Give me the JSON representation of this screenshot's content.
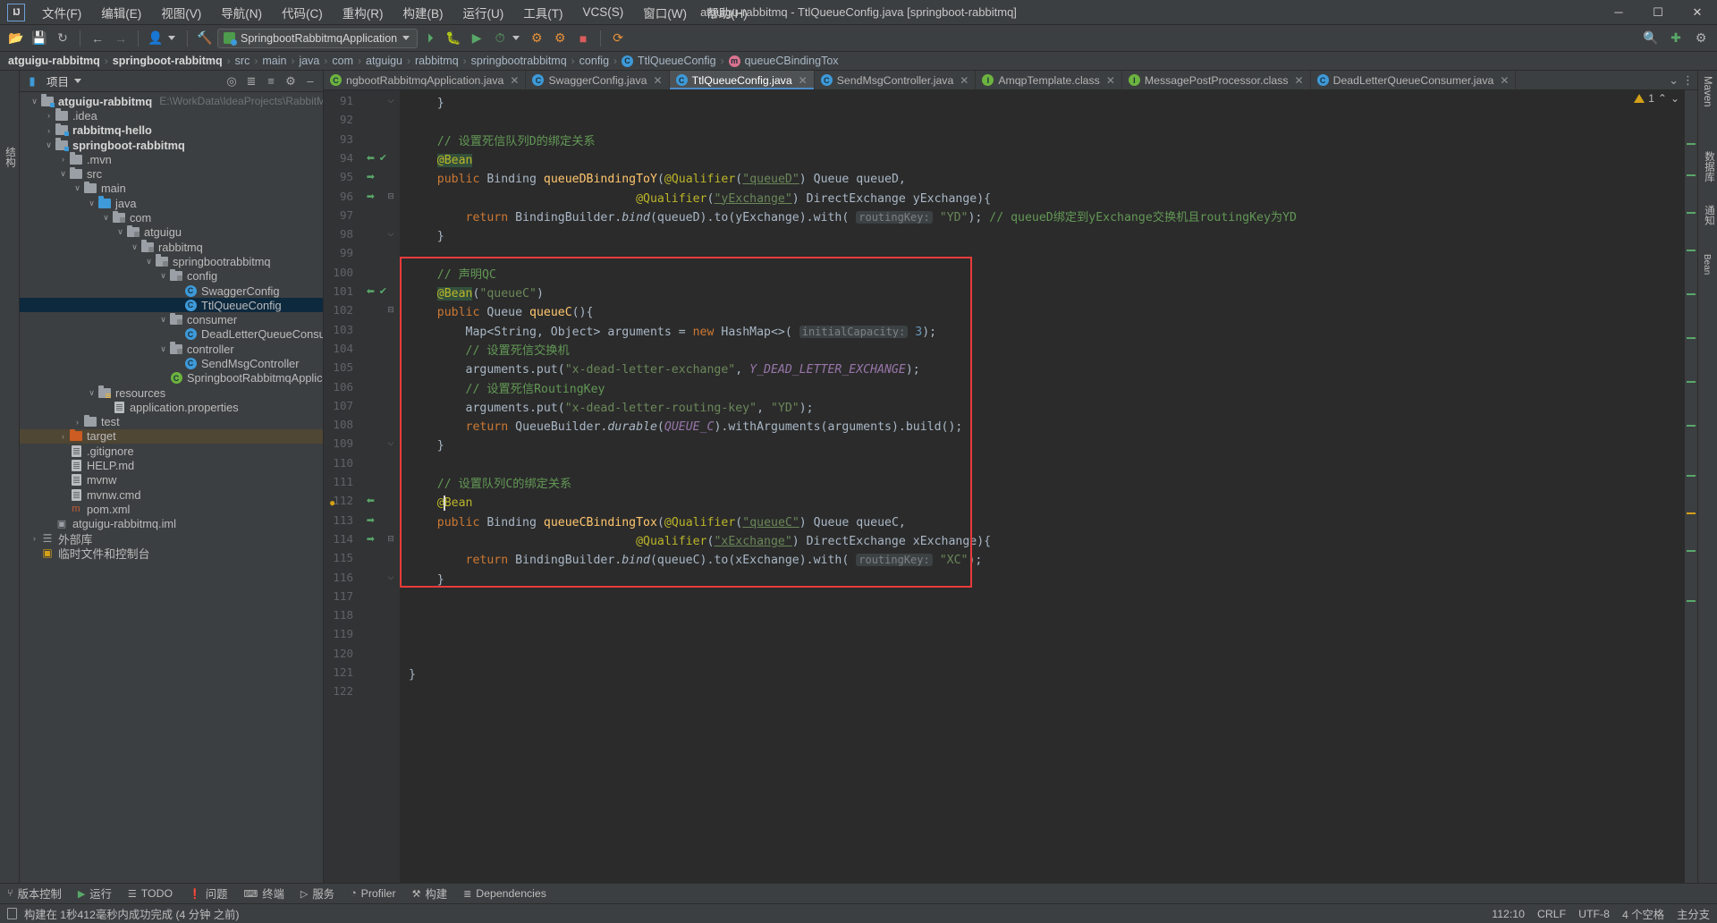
{
  "window": {
    "title": "atguigu-rabbitmq - TtlQueueConfig.java [springboot-rabbitmq]",
    "logo": "IJ",
    "minimize": "─",
    "maximize": "☐",
    "close": "✕"
  },
  "menu": [
    "文件(F)",
    "编辑(E)",
    "视图(V)",
    "导航(N)",
    "代码(C)",
    "重构(R)",
    "构建(B)",
    "运行(U)",
    "工具(T)",
    "VCS(S)",
    "窗口(W)",
    "帮助(H)"
  ],
  "toolbar": {
    "run_config": "SpringbootRabbitmqApplication",
    "icons_left": [
      "open-icon",
      "save-icon",
      "sync-icon",
      "back-icon",
      "forward-icon",
      "profile-icon",
      "hammer-icon"
    ],
    "icons_run": [
      "rerun-icon",
      "debug-icon",
      "coverage-icon",
      "profile-run-icon"
    ],
    "icons_right": [
      "search-everywhere-icon",
      "update-icon",
      "settings-icon"
    ]
  },
  "breadcrumb": [
    {
      "label": "atguigu-rabbitmq",
      "bold": true,
      "badge": ""
    },
    {
      "label": "springboot-rabbitmq",
      "bold": true,
      "badge": ""
    },
    {
      "label": "src",
      "bold": false,
      "badge": ""
    },
    {
      "label": "main",
      "bold": false,
      "badge": ""
    },
    {
      "label": "java",
      "bold": false,
      "badge": ""
    },
    {
      "label": "com",
      "bold": false,
      "badge": ""
    },
    {
      "label": "atguigu",
      "bold": false,
      "badge": ""
    },
    {
      "label": "rabbitmq",
      "bold": false,
      "badge": ""
    },
    {
      "label": "springbootrabbitmq",
      "bold": false,
      "badge": ""
    },
    {
      "label": "config",
      "bold": false,
      "badge": ""
    },
    {
      "label": "TtlQueueConfig",
      "bold": false,
      "badge": "C"
    },
    {
      "label": "queueCBindingTox",
      "bold": false,
      "badge": "m"
    }
  ],
  "project_panel": {
    "title": "项目",
    "header_icons": [
      "locate-icon",
      "expand-all-icon",
      "collapse-all-icon",
      "settings-icon",
      "hide-icon"
    ],
    "tree": [
      {
        "depth": 0,
        "arrow": "v",
        "icon": "module-folder",
        "label": "atguigu-rabbitmq",
        "bold": true,
        "path": "E:\\WorkData\\IdeaProjects\\RabbitMQ\\at",
        "state": ""
      },
      {
        "depth": 1,
        "arrow": ">",
        "icon": "folder",
        "label": ".idea",
        "bold": false,
        "path": "",
        "state": ""
      },
      {
        "depth": 1,
        "arrow": ">",
        "icon": "module-folder",
        "label": "rabbitmq-hello",
        "bold": true,
        "path": "",
        "state": ""
      },
      {
        "depth": 1,
        "arrow": "v",
        "icon": "module-folder",
        "label": "springboot-rabbitmq",
        "bold": true,
        "path": "",
        "state": ""
      },
      {
        "depth": 2,
        "arrow": ">",
        "icon": "folder",
        "label": ".mvn",
        "bold": false,
        "path": "",
        "state": ""
      },
      {
        "depth": 2,
        "arrow": "v",
        "icon": "folder",
        "label": "src",
        "bold": false,
        "path": "",
        "state": ""
      },
      {
        "depth": 3,
        "arrow": "v",
        "icon": "folder",
        "label": "main",
        "bold": false,
        "path": "",
        "state": ""
      },
      {
        "depth": 4,
        "arrow": "v",
        "icon": "source-folder",
        "label": "java",
        "bold": false,
        "path": "",
        "state": ""
      },
      {
        "depth": 5,
        "arrow": "v",
        "icon": "package",
        "label": "com",
        "bold": false,
        "path": "",
        "state": ""
      },
      {
        "depth": 6,
        "arrow": "v",
        "icon": "package",
        "label": "atguigu",
        "bold": false,
        "path": "",
        "state": ""
      },
      {
        "depth": 7,
        "arrow": "v",
        "icon": "package",
        "label": "rabbitmq",
        "bold": false,
        "path": "",
        "state": ""
      },
      {
        "depth": 8,
        "arrow": "v",
        "icon": "package",
        "label": "springbootrabbitmq",
        "bold": false,
        "path": "",
        "state": ""
      },
      {
        "depth": 9,
        "arrow": "v",
        "icon": "package",
        "label": "config",
        "bold": false,
        "path": "",
        "state": ""
      },
      {
        "depth": 10,
        "arrow": "",
        "icon": "class",
        "label": "SwaggerConfig",
        "bold": false,
        "path": "",
        "state": ""
      },
      {
        "depth": 10,
        "arrow": "",
        "icon": "class",
        "label": "TtlQueueConfig",
        "bold": false,
        "path": "",
        "state": "selected"
      },
      {
        "depth": 9,
        "arrow": "v",
        "icon": "package",
        "label": "consumer",
        "bold": false,
        "path": "",
        "state": ""
      },
      {
        "depth": 10,
        "arrow": "",
        "icon": "class",
        "label": "DeadLetterQueueConsumer",
        "bold": false,
        "path": "",
        "state": ""
      },
      {
        "depth": 9,
        "arrow": "v",
        "icon": "package",
        "label": "controller",
        "bold": false,
        "path": "",
        "state": ""
      },
      {
        "depth": 10,
        "arrow": "",
        "icon": "class",
        "label": "SendMsgController",
        "bold": false,
        "path": "",
        "state": ""
      },
      {
        "depth": 9,
        "arrow": "",
        "icon": "spring-class",
        "label": "SpringbootRabbitmqApplication",
        "bold": false,
        "path": "",
        "state": ""
      },
      {
        "depth": 4,
        "arrow": "v",
        "icon": "resource-folder",
        "label": "resources",
        "bold": false,
        "path": "",
        "state": ""
      },
      {
        "depth": 5,
        "arrow": "",
        "icon": "file",
        "label": "application.properties",
        "bold": false,
        "path": "",
        "state": ""
      },
      {
        "depth": 3,
        "arrow": ">",
        "icon": "folder",
        "label": "test",
        "bold": false,
        "path": "",
        "state": ""
      },
      {
        "depth": 2,
        "arrow": ">",
        "icon": "target-folder",
        "label": "target",
        "bold": false,
        "path": "",
        "state": "target-hl"
      },
      {
        "depth": 2,
        "arrow": "",
        "icon": "file",
        "label": ".gitignore",
        "bold": false,
        "path": "",
        "state": ""
      },
      {
        "depth": 2,
        "arrow": "",
        "icon": "file",
        "label": "HELP.md",
        "bold": false,
        "path": "",
        "state": ""
      },
      {
        "depth": 2,
        "arrow": "",
        "icon": "file",
        "label": "mvnw",
        "bold": false,
        "path": "",
        "state": ""
      },
      {
        "depth": 2,
        "arrow": "",
        "icon": "file",
        "label": "mvnw.cmd",
        "bold": false,
        "path": "",
        "state": ""
      },
      {
        "depth": 2,
        "arrow": "",
        "icon": "maven-file",
        "label": "pom.xml",
        "bold": false,
        "path": "",
        "state": ""
      },
      {
        "depth": 1,
        "arrow": "",
        "icon": "iml-file",
        "label": "atguigu-rabbitmq.iml",
        "bold": false,
        "path": "",
        "state": ""
      },
      {
        "depth": 0,
        "arrow": ">",
        "icon": "library",
        "label": "外部库",
        "bold": false,
        "path": "",
        "state": ""
      },
      {
        "depth": 0,
        "arrow": "",
        "icon": "scratch",
        "label": "临时文件和控制台",
        "bold": false,
        "path": "",
        "state": ""
      }
    ]
  },
  "left_rail": [
    "结构"
  ],
  "right_rail": [
    "Maven",
    "数据库",
    "通知",
    "Bean"
  ],
  "editor_tabs": [
    {
      "label": "ngbootRabbitmqApplication.java",
      "icon": "spring-class",
      "active": false
    },
    {
      "label": "SwaggerConfig.java",
      "icon": "class",
      "active": false
    },
    {
      "label": "TtlQueueConfig.java",
      "icon": "class",
      "active": true
    },
    {
      "label": "SendMsgController.java",
      "icon": "class",
      "active": false
    },
    {
      "label": "AmqpTemplate.class",
      "icon": "interface",
      "active": false
    },
    {
      "label": "MessagePostProcessor.class",
      "icon": "interface",
      "active": false
    },
    {
      "label": "DeadLetterQueueConsumer.java",
      "icon": "class",
      "active": false
    }
  ],
  "inspection": {
    "count": "1",
    "up": "⌃",
    "down": "⌄"
  },
  "code": {
    "first_line": 91,
    "lines": [
      {
        "n": 91,
        "fold": "end",
        "marks": [],
        "html": "    <span class='txt'>}</span>"
      },
      {
        "n": 92,
        "fold": "",
        "marks": [],
        "html": ""
      },
      {
        "n": 93,
        "fold": "",
        "marks": [],
        "html": "    <span class='cmt'>// 设置死信队列D的绑定关系</span>"
      },
      {
        "n": 94,
        "fold": "",
        "marks": [
          "bean",
          "check"
        ],
        "html": "    <span class='ann annhl'>@Bean</span>"
      },
      {
        "n": 95,
        "fold": "",
        "marks": [
          "bean-go"
        ],
        "html": "    <span class='kw'>public</span> <span class='typ'>Binding</span> <span class='mtd'>queueDBindingToY</span><span class='txt'>(</span><span class='ann'>@Qualifier</span><span class='txt'>(</span><span class='str ulink'>\"queueD\"</span><span class='txt'>) Queue queueD,</span>"
      },
      {
        "n": 96,
        "fold": "start",
        "marks": [
          "bean-go"
        ],
        "html": "                                <span class='ann'>@Qualifier</span><span class='txt'>(</span><span class='str ulink'>\"yExchange\"</span><span class='txt'>) DirectExchange yExchange){</span>"
      },
      {
        "n": 97,
        "fold": "",
        "marks": [],
        "html": "        <span class='kw'>return</span> <span class='txt'>BindingBuilder.</span><span class='typ' style='font-style:italic'>bind</span><span class='txt'>(queueD).to(yExchange).with(</span> <span class='hint'>routingKey:</span> <span class='str'>\"YD\"</span><span class='txt'>); </span><span class='cmt'>// queueD绑定到yExchange交换机且routingKey为YD</span>"
      },
      {
        "n": 98,
        "fold": "end",
        "marks": [],
        "html": "    <span class='txt'>}</span>"
      },
      {
        "n": 99,
        "fold": "",
        "marks": [],
        "html": ""
      },
      {
        "n": 100,
        "fold": "",
        "marks": [],
        "html": "    <span class='cmt'>// 声明QC</span>"
      },
      {
        "n": 101,
        "fold": "",
        "marks": [
          "bean",
          "check"
        ],
        "html": "    <span class='ann annhl'>@Bean</span><span class='txt'>(</span><span class='str'>\"queueC\"</span><span class='txt'>)</span>"
      },
      {
        "n": 102,
        "fold": "start",
        "marks": [],
        "html": "    <span class='kw'>public</span> <span class='typ'>Queue</span> <span class='mtd'>queueC</span><span class='txt'>(){</span>"
      },
      {
        "n": 103,
        "fold": "",
        "marks": [],
        "html": "        <span class='txt'>Map&lt;String, Object&gt; arguments = </span><span class='kw'>new</span><span class='txt'> HashMap&lt;&gt;(</span> <span class='hint'>initialCapacity:</span> <span class='num'>3</span><span class='txt'>);</span>"
      },
      {
        "n": 104,
        "fold": "",
        "marks": [],
        "html": "        <span class='cmt'>// 设置死信交换机</span>"
      },
      {
        "n": 105,
        "fold": "",
        "marks": [],
        "html": "        <span class='txt'>arguments.put(</span><span class='str'>\"x-dead-letter-exchange\"</span><span class='txt'>, </span><span class='stat'>Y_DEAD_LETTER_EXCHANGE</span><span class='txt'>);</span>"
      },
      {
        "n": 106,
        "fold": "",
        "marks": [],
        "html": "        <span class='cmt'>// 设置死信RoutingKey</span>"
      },
      {
        "n": 107,
        "fold": "",
        "marks": [],
        "html": "        <span class='txt'>arguments.put(</span><span class='str'>\"x-dead-letter-routing-key\"</span><span class='txt'>, </span><span class='str'>\"YD\"</span><span class='txt'>);</span>"
      },
      {
        "n": 108,
        "fold": "",
        "marks": [],
        "html": "        <span class='kw'>return</span> <span class='txt'>QueueBuilder.</span><span class='typ' style='font-style:italic'>durable</span><span class='txt'>(</span><span class='stat'>QUEUE_C</span><span class='txt'>).withArguments(arguments).build();</span>"
      },
      {
        "n": 109,
        "fold": "end",
        "marks": [],
        "html": "    <span class='txt'>}</span>"
      },
      {
        "n": 110,
        "fold": "",
        "marks": [],
        "html": ""
      },
      {
        "n": 111,
        "fold": "",
        "marks": [],
        "html": "    <span class='cmt'>// 设置队列C的绑定关系</span>"
      },
      {
        "n": 112,
        "fold": "",
        "marks": [
          "bean"
        ],
        "html": "    <span class='ann'>@Bean</span>"
      },
      {
        "n": 113,
        "fold": "",
        "marks": [
          "bean-go"
        ],
        "html": "    <span class='kw'>public</span> <span class='typ'>Binding</span> <span class='mtd'>queueCBindingTox</span><span class='txt'>(</span><span class='ann'>@Qualifier</span><span class='txt'>(</span><span class='str ulink'>\"queueC\"</span><span class='txt'>) Queue queueC,</span>"
      },
      {
        "n": 114,
        "fold": "start",
        "marks": [
          "bean-go"
        ],
        "html": "                                <span class='ann'>@Qualifier</span><span class='txt'>(</span><span class='str ulink'>\"xExchange\"</span><span class='txt'>) DirectExchange xExchange){</span>"
      },
      {
        "n": 115,
        "fold": "",
        "marks": [],
        "html": "        <span class='kw'>return</span> <span class='txt'>BindingBuilder.</span><span class='typ' style='font-style:italic'>bind</span><span class='txt'>(queueC).to(xExchange).with(</span> <span class='hint'>routingKey:</span> <span class='str'>\"XC\"</span><span class='txt'>);</span>"
      },
      {
        "n": 116,
        "fold": "end",
        "marks": [],
        "html": "    <span class='txt'>}</span>"
      },
      {
        "n": 117,
        "fold": "",
        "marks": [],
        "html": ""
      },
      {
        "n": 118,
        "fold": "",
        "marks": [],
        "html": ""
      },
      {
        "n": 119,
        "fold": "",
        "marks": [],
        "html": ""
      },
      {
        "n": 120,
        "fold": "",
        "marks": [],
        "html": ""
      },
      {
        "n": 121,
        "fold": "",
        "marks": [],
        "html": "<span class='txt'>}</span>"
      },
      {
        "n": 122,
        "fold": "",
        "marks": [],
        "html": ""
      }
    ]
  },
  "tool_windows": [
    {
      "label": "版本控制",
      "icon": "branch-icon"
    },
    {
      "label": "运行",
      "icon": "run-icon"
    },
    {
      "label": "TODO",
      "icon": "todo-icon"
    },
    {
      "label": "问题",
      "icon": "problems-icon"
    },
    {
      "label": "终端",
      "icon": "terminal-icon"
    },
    {
      "label": "服务",
      "icon": "services-icon"
    },
    {
      "label": "Profiler",
      "icon": "profiler-icon"
    },
    {
      "label": "构建",
      "icon": "build-icon"
    },
    {
      "label": "Dependencies",
      "icon": "dependencies-icon"
    }
  ],
  "status_bar": {
    "message": "构建在 1秒412毫秒内成功完成 (4 分钟 之前)",
    "caret": "112:10",
    "line_sep": "CRLF",
    "encoding": "UTF-8",
    "indent": "4 个空格",
    "branch": "主分支"
  },
  "colors": {
    "accent": "#4a88c7",
    "selection": "#0d293e",
    "redbox": "#e93b3b",
    "string": "#6a8759",
    "comment": "#629755",
    "keyword": "#cc7832",
    "annotation": "#bbb529",
    "method": "#ffc66d",
    "number": "#6897bb",
    "field": "#9876aa"
  }
}
